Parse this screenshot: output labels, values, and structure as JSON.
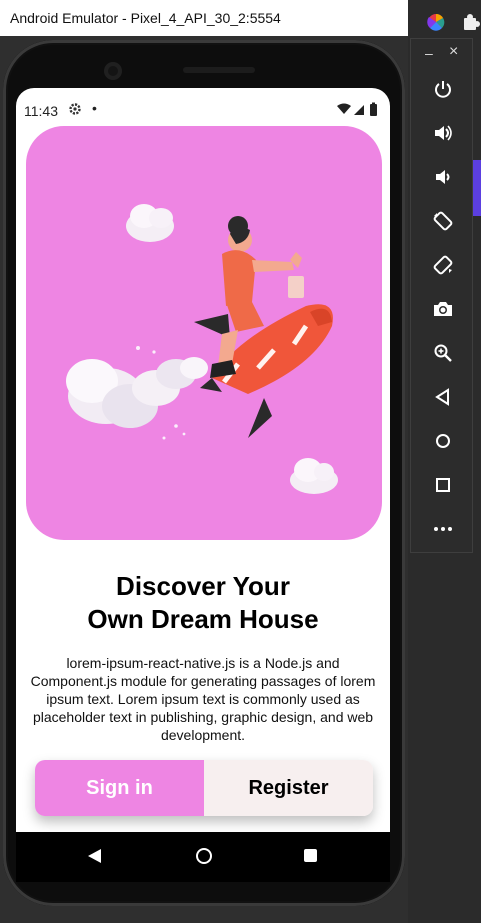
{
  "window": {
    "title": "Android Emulator - Pixel_4_API_30_2:5554"
  },
  "status_bar": {
    "time": "11:43",
    "dot": "•"
  },
  "hero": {
    "background_color": "#ee85e3",
    "illustration": "rocket-girl-illustration"
  },
  "content": {
    "title_line1": "Discover Your",
    "title_line2": "Own Dream House",
    "description": "lorem-ipsum-react-native.js is a Node.js and Component.js module for generating passages of lorem ipsum text. Lorem ipsum text is commonly used as placeholder text in publishing, graphic design, and web development."
  },
  "buttons": {
    "signin_label": "Sign in",
    "register_label": "Register",
    "signin_color": "#ee85e3",
    "register_color": "#f7efef"
  },
  "nav": {
    "back": "back-icon",
    "home": "home-icon",
    "recents": "recents-icon"
  },
  "toolbar": {
    "minimize": "–",
    "close": "×",
    "items": [
      "power-icon",
      "volume-up-icon",
      "volume-down-icon",
      "rotate-left-icon",
      "rotate-right-icon",
      "camera-icon",
      "zoom-icon",
      "back-icon",
      "home-icon",
      "overview-icon",
      "more-icon"
    ]
  }
}
